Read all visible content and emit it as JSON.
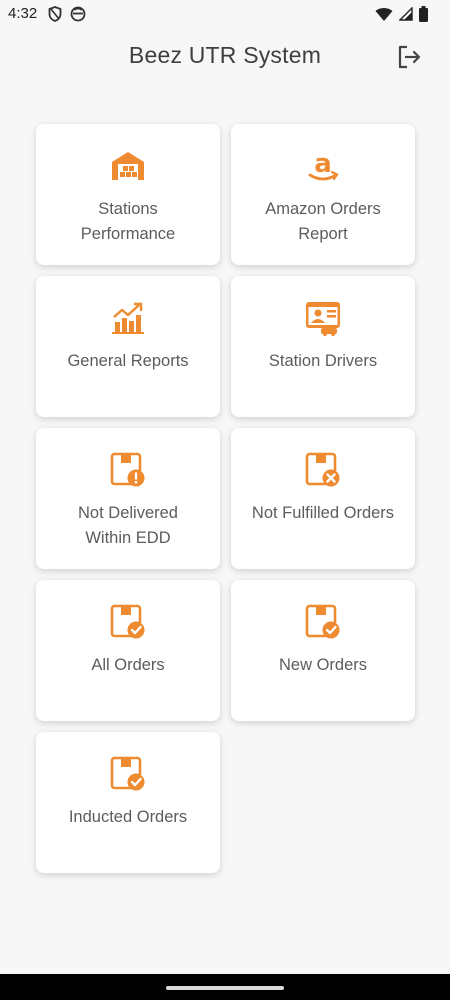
{
  "status_bar": {
    "time": "4:32"
  },
  "header": {
    "title": "Beez UTR System"
  },
  "colors": {
    "accent": "#ee8a2f",
    "background": "#f7f7f7",
    "card": "#ffffff",
    "text": "#5c5c5c"
  },
  "menu": {
    "items": [
      {
        "label": "Stations\nPerformance",
        "icon": "warehouse-icon"
      },
      {
        "label": "Amazon Orders\nReport",
        "icon": "amazon-icon"
      },
      {
        "label": "General Reports",
        "icon": "chart-growth-icon"
      },
      {
        "label": "Station Drivers",
        "icon": "driver-card-icon"
      },
      {
        "label": "Not Delivered\nWithin EDD",
        "icon": "box-alert-icon"
      },
      {
        "label": "Not Fulfilled Orders",
        "icon": "box-cancel-icon"
      },
      {
        "label": "All Orders",
        "icon": "box-check-icon"
      },
      {
        "label": "New Orders",
        "icon": "box-check-icon"
      },
      {
        "label": "Inducted Orders",
        "icon": "box-check-icon"
      }
    ]
  }
}
